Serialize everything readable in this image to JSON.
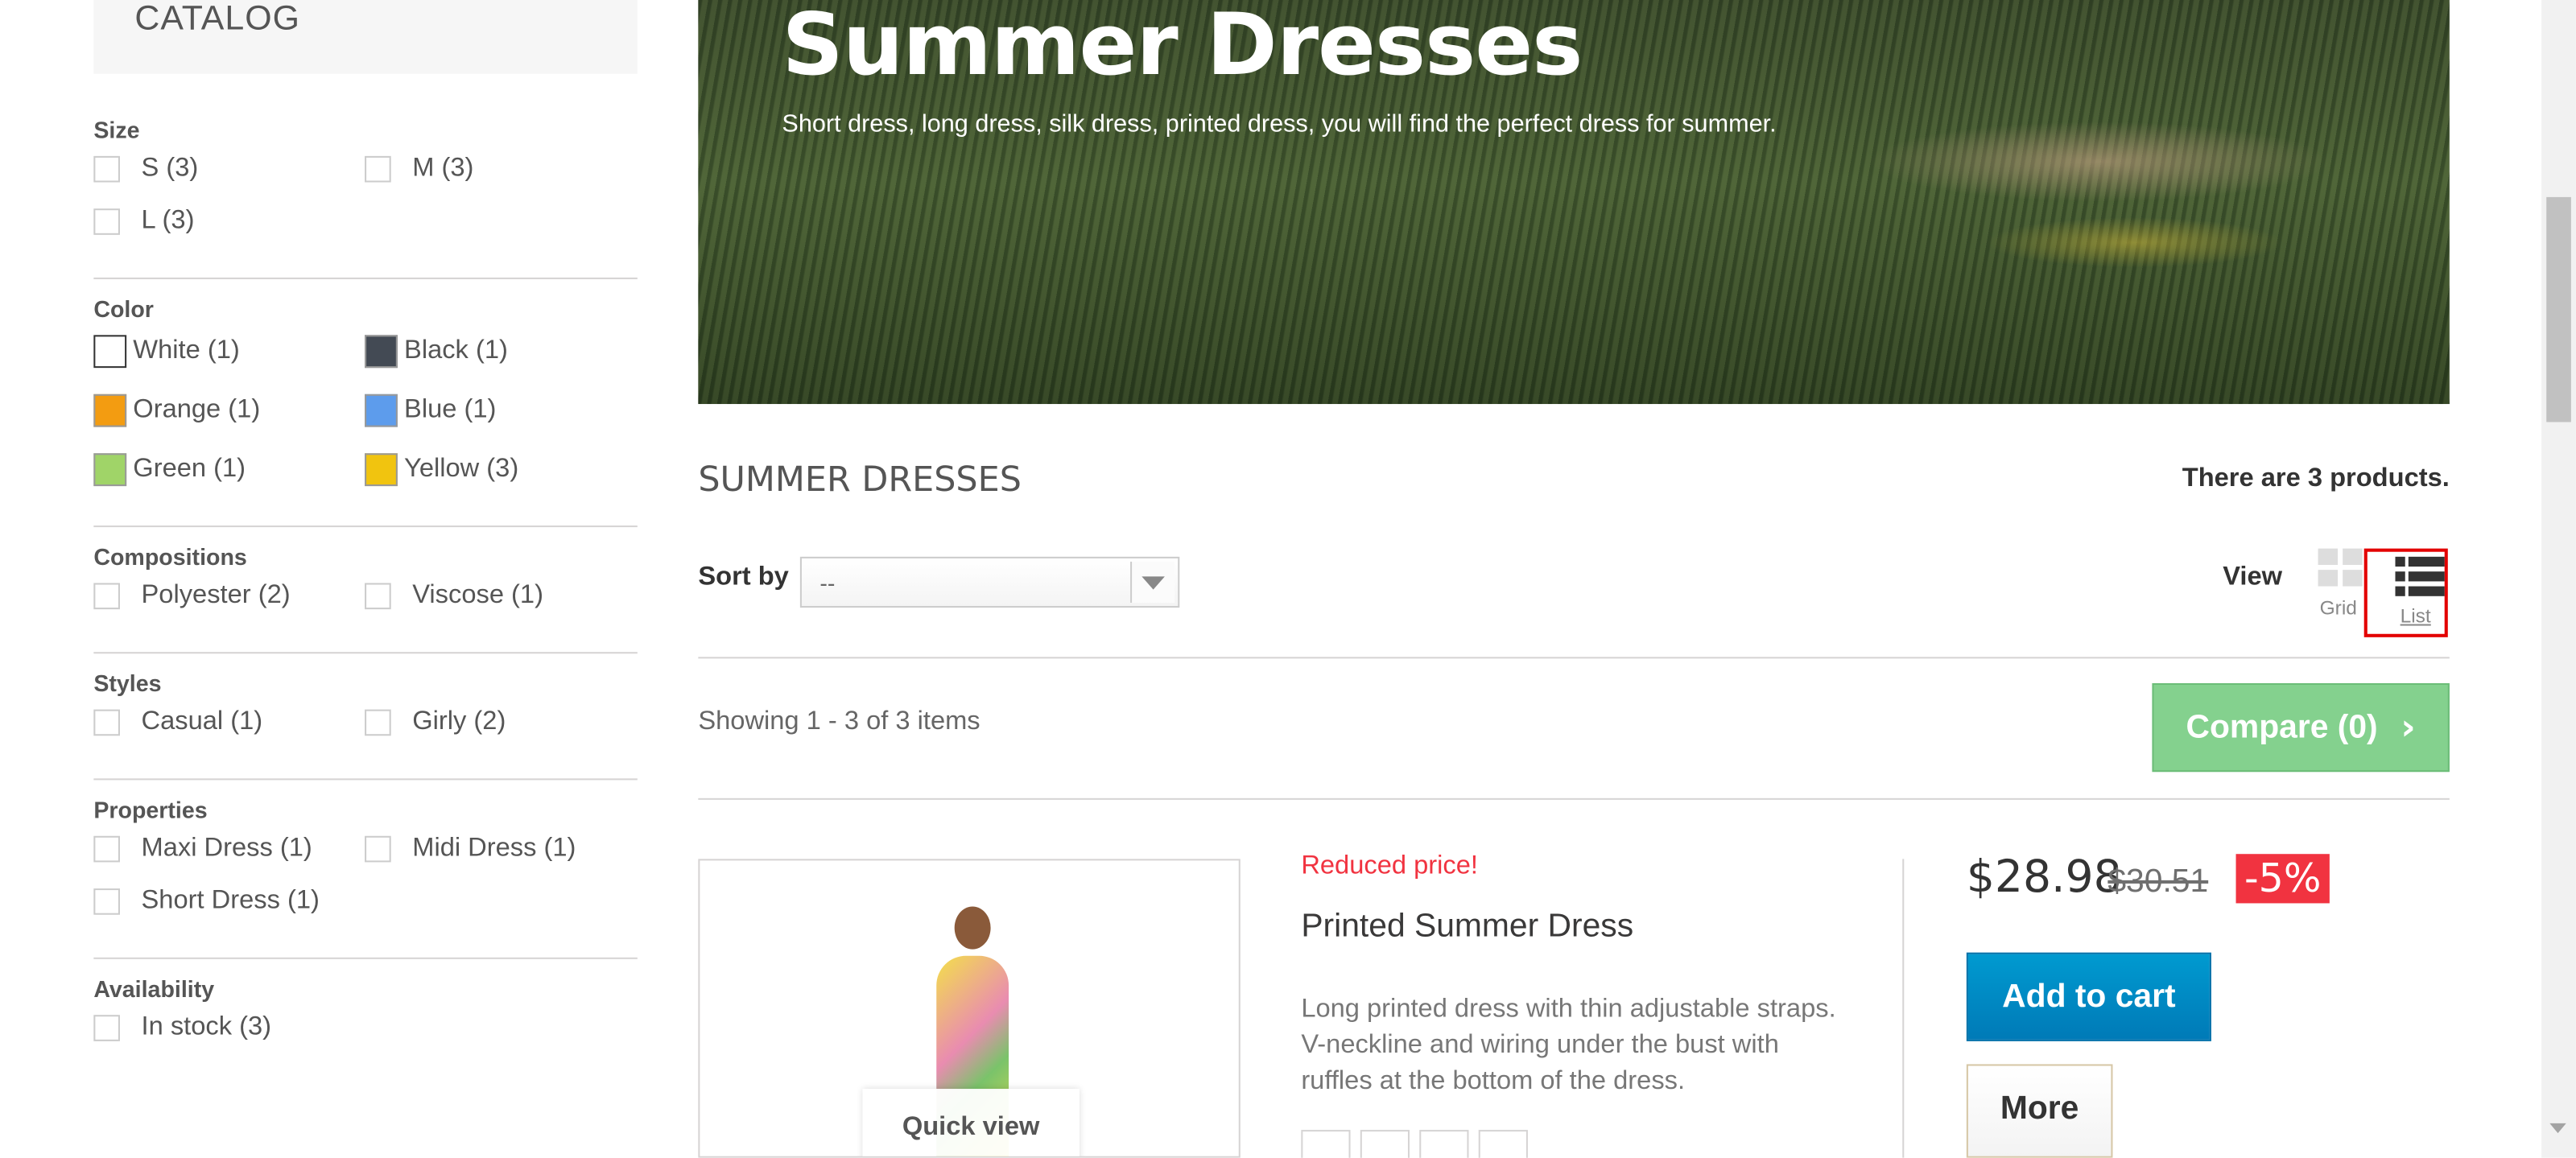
{
  "sidebar": {
    "title": "CATALOG",
    "size": {
      "title": "Size",
      "items": [
        "S (3)",
        "M (3)",
        "L (3)"
      ]
    },
    "color": {
      "title": "Color",
      "items": [
        {
          "label": "White (1)",
          "color": "#ffffff"
        },
        {
          "label": "Black (1)",
          "color": "#434a54"
        },
        {
          "label": "Orange (1)",
          "color": "#f39c11"
        },
        {
          "label": "Blue (1)",
          "color": "#5d9cec"
        },
        {
          "label": "Green (1)",
          "color": "#a0d468"
        },
        {
          "label": "Yellow (3)",
          "color": "#f1c40f"
        }
      ]
    },
    "compositions": {
      "title": "Compositions",
      "items": [
        "Polyester (2)",
        "Viscose (1)"
      ]
    },
    "styles": {
      "title": "Styles",
      "items": [
        "Casual (1)",
        "Girly (2)"
      ]
    },
    "properties": {
      "title": "Properties",
      "items": [
        "Maxi Dress (1)",
        "Midi Dress (1)",
        "Short Dress (1)"
      ]
    },
    "availability": {
      "title": "Availability",
      "items": [
        "In stock (3)"
      ]
    }
  },
  "banner": {
    "title": "Summer Dresses",
    "description": "Short dress, long dress, silk dress, printed dress, you will find the perfect dress for summer."
  },
  "category": {
    "name": "SUMMER DRESSES",
    "product_count": "There are 3 products."
  },
  "toolbar": {
    "sort_label": "Sort by",
    "sort_value": "--",
    "view_label": "View",
    "grid_label": "Grid",
    "list_label": "List",
    "showing": "Showing 1 - 3 of 3 items",
    "compare": "Compare (0)"
  },
  "product": {
    "badge": "Reduced price!",
    "name": "Printed Summer Dress",
    "description_lines": [
      "Long printed dress with thin adjustable straps.",
      "V-neckline and wiring under the bust with",
      "ruffles at the bottom of the dress."
    ],
    "price": "$28.98",
    "old_price": "$30.51",
    "discount": "-5%",
    "add_to_cart": "Add to cart",
    "more": "More",
    "quick_view": "Quick view"
  },
  "colors": {
    "reduced": "#f13340",
    "add_to_cart": "#0088c6",
    "compare": "#84d18e",
    "highlight_box": "#e30000"
  }
}
